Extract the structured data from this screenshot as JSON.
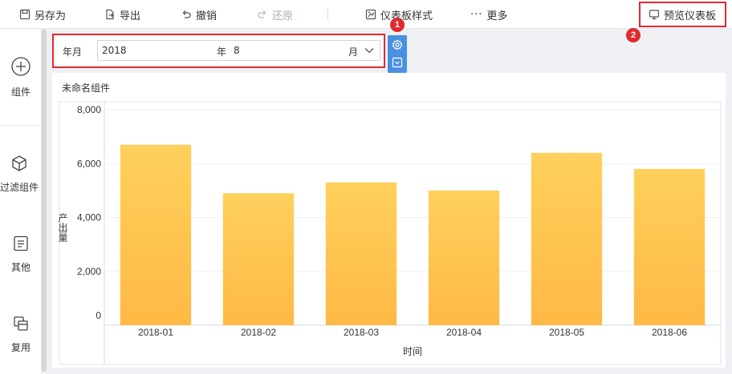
{
  "toolbar": {
    "save_as": "另存为",
    "export": "导出",
    "undo": "撤销",
    "redo": "还原",
    "dashboard_style": "仪表板样式",
    "more": "更多",
    "preview": "预览仪表板"
  },
  "sidebar": {
    "items": [
      {
        "label": "组件",
        "icon": "plus-circle-icon"
      },
      {
        "label": "过滤组件",
        "icon": "cube-icon"
      },
      {
        "label": "其他",
        "icon": "document-icon"
      },
      {
        "label": "复用",
        "icon": "copy-icon"
      }
    ]
  },
  "filter": {
    "label": "年月",
    "year_value": "2018",
    "year_unit": "年",
    "month_value": "8",
    "month_unit": "月"
  },
  "callouts": [
    "1",
    "2"
  ],
  "colors": {
    "bar_top": "#ffd05c",
    "bar_bottom": "#ffb945",
    "highlight": "#e02a2f",
    "tool_blue": "#4a90e2"
  },
  "chart": {
    "title": "未命名组件"
  },
  "chart_data": {
    "type": "bar",
    "categories": [
      "2018-01",
      "2018-02",
      "2018-03",
      "2018-04",
      "2018-05",
      "2018-06"
    ],
    "values": [
      6700,
      4900,
      5300,
      5000,
      6400,
      5800
    ],
    "xlabel": "时间",
    "ylabel": "产出量",
    "ylim": [
      0,
      8000
    ],
    "yticks": [
      "0",
      "2,000",
      "4,000",
      "6,000",
      "8,000"
    ],
    "ytick_values": [
      0,
      2000,
      4000,
      6000,
      8000
    ],
    "grid": true
  }
}
